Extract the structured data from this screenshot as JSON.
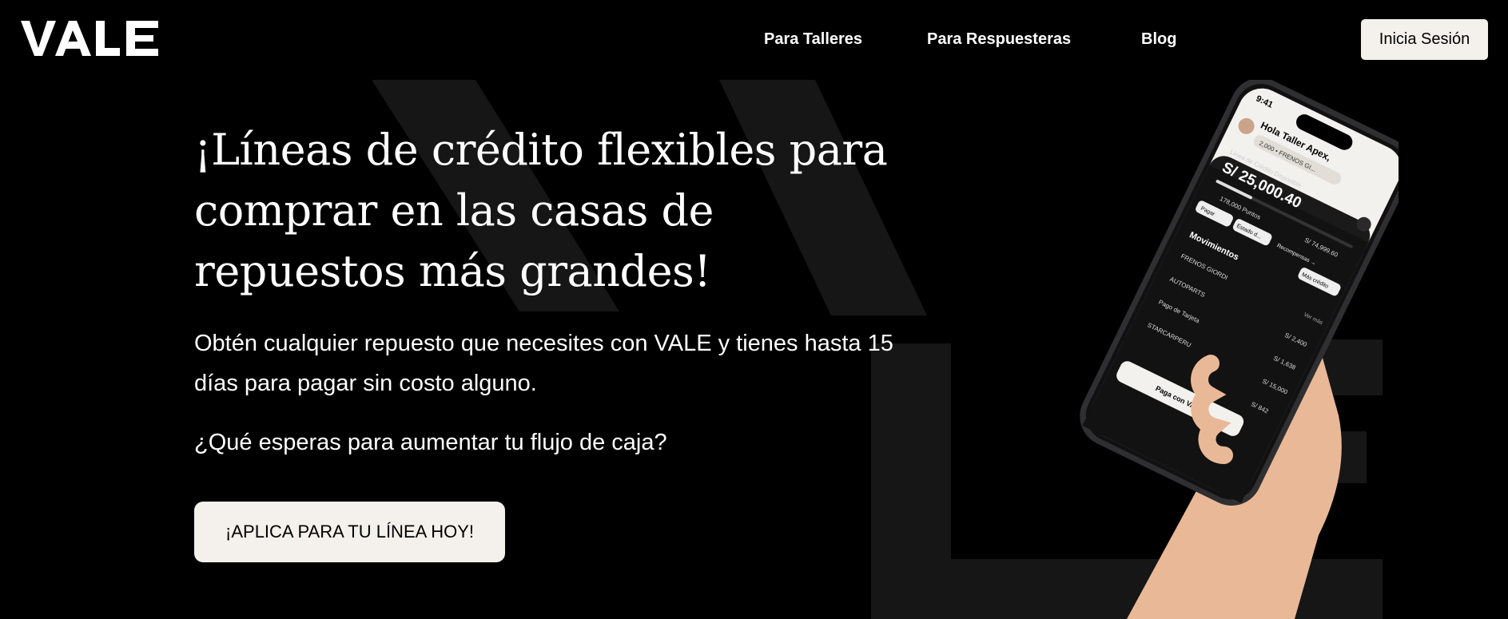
{
  "brand": {
    "name": "VALE"
  },
  "nav": {
    "items": [
      {
        "label": "Para Talleres"
      },
      {
        "label": "Para Respuesteras"
      },
      {
        "label": "Blog"
      }
    ],
    "login_label": "Inicia Sesión"
  },
  "hero": {
    "title": "¡Líneas de crédito flexibles para comprar en las casas de repuestos más grandes!",
    "description": "Obtén cualquier repuesto que necesites con VALE y tienes hasta 15 días para pagar sin costo alguno.",
    "question": "¿Qué esperas para aumentar tu flujo de caja?",
    "cta_label": "¡APLICA PARA TU LÍNEA HOY!"
  },
  "phone": {
    "time": "9:41",
    "greeting": "Hola Taller Apex,",
    "chip": "2,000 • FRENOS GI...",
    "credit_label": "Línea de Crédito Disponible",
    "credit_amount": "S/ 25,000.40",
    "points": "178,000 Puntos",
    "total": "S/ 74,999.60",
    "actions": [
      "Pagar",
      "Estado d...",
      "Recompensas →",
      "Más crédito"
    ],
    "movements_title": "Movimientos",
    "see_more": "Ver más",
    "movements": [
      {
        "name": "FRENOS GIORDI",
        "amount": ""
      },
      {
        "name": "AUTOPARTS",
        "amount": "S/ 2,400"
      },
      {
        "name": "Pago de Tarjeta",
        "amount": "S/ 1,638"
      },
      {
        "name": "STARCARPERU",
        "amount": "S/ 15,000"
      },
      {
        "name": "",
        "amount": "S/ 842"
      }
    ],
    "pay_button": "Paga con VALE"
  },
  "colors": {
    "background": "#000000",
    "button_bg": "#f4f1ec",
    "watermark": "#1c1c1c",
    "text": "#ffffff"
  }
}
